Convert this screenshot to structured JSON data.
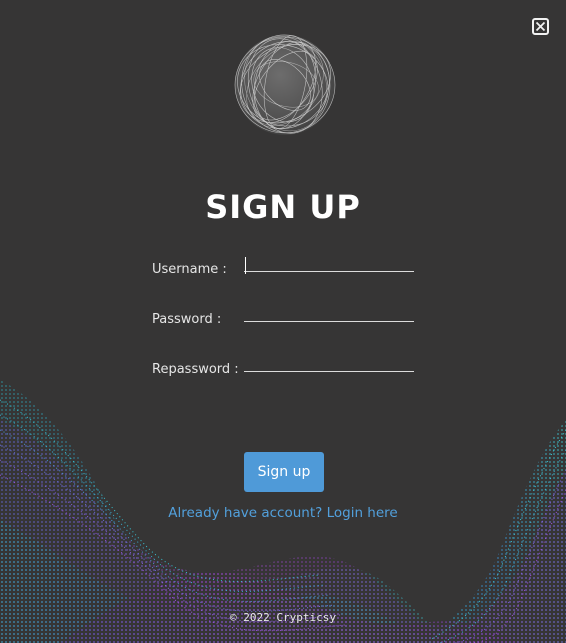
{
  "title": "SIGN UP",
  "form": {
    "username_label": "Username :",
    "username_value": "",
    "password_label": "Password :",
    "password_value": "",
    "repassword_label": "Repassword :",
    "repassword_value": ""
  },
  "buttons": {
    "signup_label": "Sign up",
    "close_icon": "close-icon"
  },
  "links": {
    "login_text": "Already have account? Login here"
  },
  "footer": {
    "copyright": "© 2022 Crypticsy"
  },
  "colors": {
    "background": "#363535",
    "accent": "#4f9ad8",
    "link": "#52a0dc",
    "wave_cyan": "#3fd0d8",
    "wave_purple": "#a24be0"
  }
}
